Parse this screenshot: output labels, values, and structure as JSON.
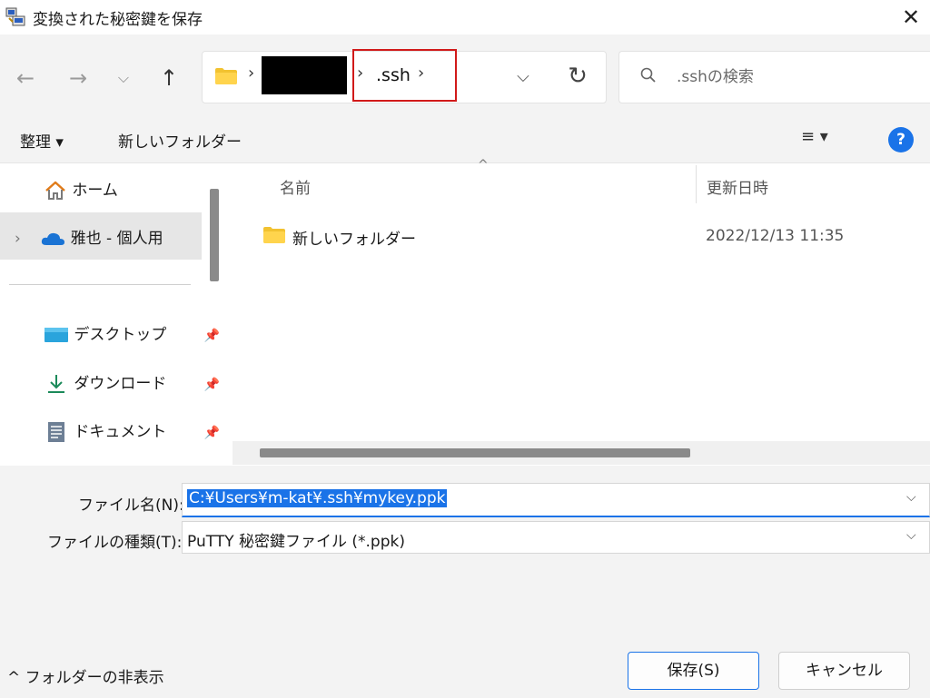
{
  "window": {
    "title": "変換された秘密鍵を保存",
    "close_glyph": "✕"
  },
  "nav": {
    "back_glyph": "←",
    "forward_glyph": "→",
    "recent_glyph": "⌵",
    "up_glyph": "↑",
    "breadcrumb_sep": "›",
    "breadcrumb_current": ".ssh",
    "dropdown_glyph": "⌵",
    "refresh_glyph": "↻"
  },
  "search": {
    "placeholder": ".sshの検索"
  },
  "commandbar": {
    "organize_label": "整理 ▾",
    "new_folder_label": "新しいフォルダー",
    "view_label": "≡ ▾",
    "help_label": "?"
  },
  "sidebar": {
    "items": [
      {
        "label": "ホーム",
        "icon": "home-icon"
      },
      {
        "label": "雅也 - 個人用",
        "icon": "onedrive-cloud-icon",
        "expand_glyph": "›"
      },
      {
        "label": "デスクトップ",
        "icon": "desktop-icon",
        "pinned": true
      },
      {
        "label": "ダウンロード",
        "icon": "download-icon",
        "pinned": true
      },
      {
        "label": "ドキュメント",
        "icon": "document-icon",
        "pinned": true
      }
    ],
    "pin_glyph": "📌"
  },
  "filelist": {
    "columns": {
      "name": "名前",
      "date": "更新日時"
    },
    "sort_glyph": "^",
    "rows": [
      {
        "name": "新しいフォルダー",
        "date": "2022/12/13 11:35",
        "type": "folder"
      }
    ]
  },
  "form": {
    "filename_label": "ファイル名(N):",
    "filename_value": "C:¥Users¥m-kat¥.ssh¥mykey.ppk",
    "filetype_label": "ファイルの種類(T):",
    "filetype_value": "PuTTY 秘密鍵ファイル (*.ppk)",
    "dropdown_glyph": "⌵"
  },
  "footer": {
    "hide_folders_label": "^ フォルダーの非表示",
    "save_label": "保存(S)",
    "cancel_label": "キャンセル"
  },
  "colors": {
    "accent": "#1a73e8",
    "highlight_box": "#d11a1a",
    "chrome_bg": "#f3f3f3"
  }
}
